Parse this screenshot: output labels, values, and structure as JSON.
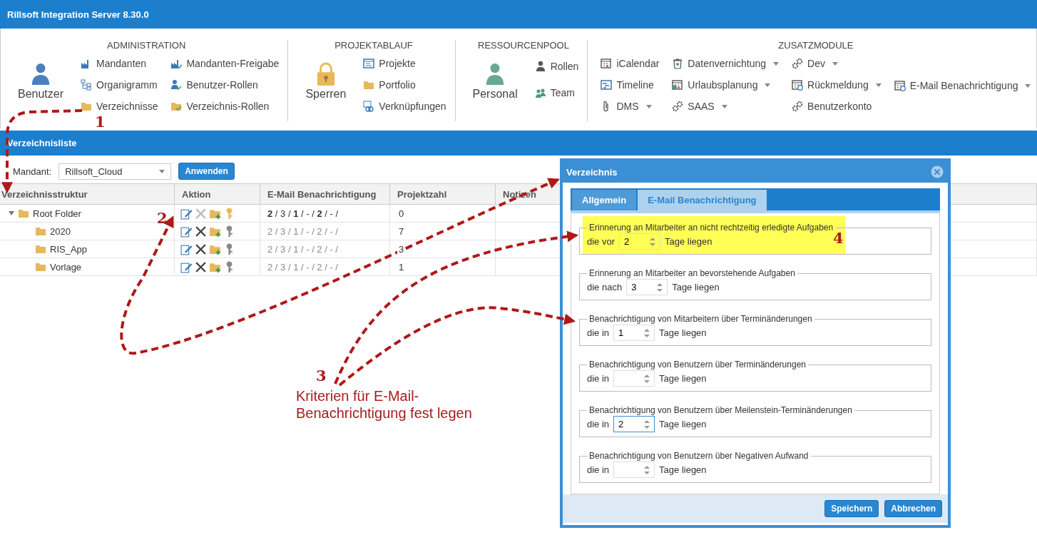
{
  "window": {
    "title": "Rillsoft Integration Server 8.30.0"
  },
  "ribbon": {
    "groups": [
      {
        "title": "ADMINISTRATION",
        "big": {
          "label": "Benutzer"
        },
        "columns": [
          [
            {
              "label": "Mandanten",
              "dropdown": false
            },
            {
              "label": "Organigramm",
              "dropdown": false
            },
            {
              "label": "Verzeichnisse",
              "dropdown": false
            }
          ],
          [
            {
              "label": "Mandanten-Freigabe",
              "dropdown": false
            },
            {
              "label": "Benutzer-Rollen",
              "dropdown": false
            },
            {
              "label": "Verzeichnis-Rollen",
              "dropdown": false
            }
          ]
        ]
      },
      {
        "title": "PROJEKTABLAUF",
        "big": {
          "label": "Sperren"
        },
        "columns": [
          [
            {
              "label": "Projekte",
              "dropdown": false
            },
            {
              "label": "Portfolio",
              "dropdown": false
            },
            {
              "label": "Verknüpfungen",
              "dropdown": false
            }
          ]
        ]
      },
      {
        "title": "RESSOURCENPOOL",
        "big": {
          "label": "Personal"
        },
        "columns": [
          [
            {
              "label": "Rollen",
              "dropdown": false
            },
            {
              "label": "Team",
              "dropdown": false
            }
          ]
        ]
      },
      {
        "title": "ZUSATZMODULE",
        "columns": [
          [
            {
              "label": "iCalendar",
              "dropdown": false
            },
            {
              "label": "Timeline",
              "dropdown": false
            },
            {
              "label": "DMS",
              "dropdown": true
            }
          ],
          [
            {
              "label": "Datenvernichtung",
              "dropdown": true
            },
            {
              "label": "Urlaubsplanung",
              "dropdown": true
            },
            {
              "label": "SAAS",
              "dropdown": true
            }
          ],
          [
            {
              "label": "Dev",
              "dropdown": true
            },
            {
              "label": "Rückmeldung",
              "dropdown": true
            },
            {
              "label": "Benutzerkonto",
              "dropdown": false
            }
          ],
          [
            {
              "label": "E-Mail Benachrichtigung",
              "dropdown": true
            }
          ]
        ]
      }
    ]
  },
  "section": {
    "title": "Verzeichnisliste"
  },
  "toolbar": {
    "mandant_label": "Mandant:",
    "mandant_value": "Rillsoft_Cloud",
    "apply_button": "Anwenden"
  },
  "table": {
    "columns": [
      "Verzeichnisstruktur",
      "Aktion",
      "E-Mail Benachrichtigung",
      "Projektzahl",
      "Notizen"
    ],
    "rows": [
      {
        "name": "Root Folder",
        "expanded": true,
        "can_delete": false,
        "key_set": true,
        "notification": "**2** / 3 / **1** / - / **2** / - /",
        "inherited": false,
        "count": "0",
        "children": [
          {
            "name": "2020",
            "can_delete": true,
            "key_set": false,
            "notification": "2 / 3 / 1 / - / 2 / - /",
            "inherited": true,
            "count": "7"
          },
          {
            "name": "RIS_App",
            "can_delete": true,
            "key_set": false,
            "notification": "2 / 3 / 1 / - / 2 / - /",
            "inherited": true,
            "count": "3"
          },
          {
            "name": "Vorlage",
            "can_delete": true,
            "key_set": false,
            "notification": "2 / 3 / 1 / - / 2 / - /",
            "inherited": true,
            "count": "1"
          }
        ]
      }
    ]
  },
  "dialog": {
    "title": "Verzeichnis",
    "tabs": [
      {
        "label": "Allgemein",
        "selected": false
      },
      {
        "label": "E-Mail Benachrichtigung",
        "selected": true
      }
    ],
    "fieldsets": [
      {
        "legend": "Erinnerung an Mitarbeiter an nicht rechtzeitig erledigte Aufgaben",
        "prefix": "die vor",
        "value": "2",
        "suffix": "Tage liegen",
        "focused": false,
        "highlighted": true
      },
      {
        "legend": "Erinnerung an Mitarbeiter an bevorstehende Aufgaben",
        "prefix": "die nach",
        "value": "3",
        "suffix": "Tage liegen",
        "focused": false,
        "highlighted": false
      },
      {
        "legend": "Benachrichtigung von Mitarbeitern über Terminänderungen",
        "prefix": "die in",
        "value": "1",
        "suffix": "Tage liegen",
        "focused": false,
        "highlighted": false
      },
      {
        "legend": "Benachrichtigung von Benutzern über Terminänderungen",
        "prefix": "die in",
        "suffix": "Tage liegen",
        "focused": false,
        "highlighted": false
      },
      {
        "legend": "Benachrichtigung von Benutzern über Meilenstein-Terminänderungen",
        "prefix": "die in",
        "value": "2",
        "suffix": "Tage liegen",
        "focused": true,
        "highlighted": false
      },
      {
        "legend": "Benachrichtigung von Benutzern über Negativen Aufwand",
        "prefix": "die in",
        "suffix": "Tage liegen",
        "focused": false,
        "highlighted": false
      }
    ],
    "buttons": [
      "Speichern",
      "Abbrechen"
    ]
  },
  "annotations": {
    "markers": [
      "1",
      "2",
      "3",
      "4"
    ],
    "note": "Kriterien für E-Mail-Benachrichtigung fest legen"
  }
}
